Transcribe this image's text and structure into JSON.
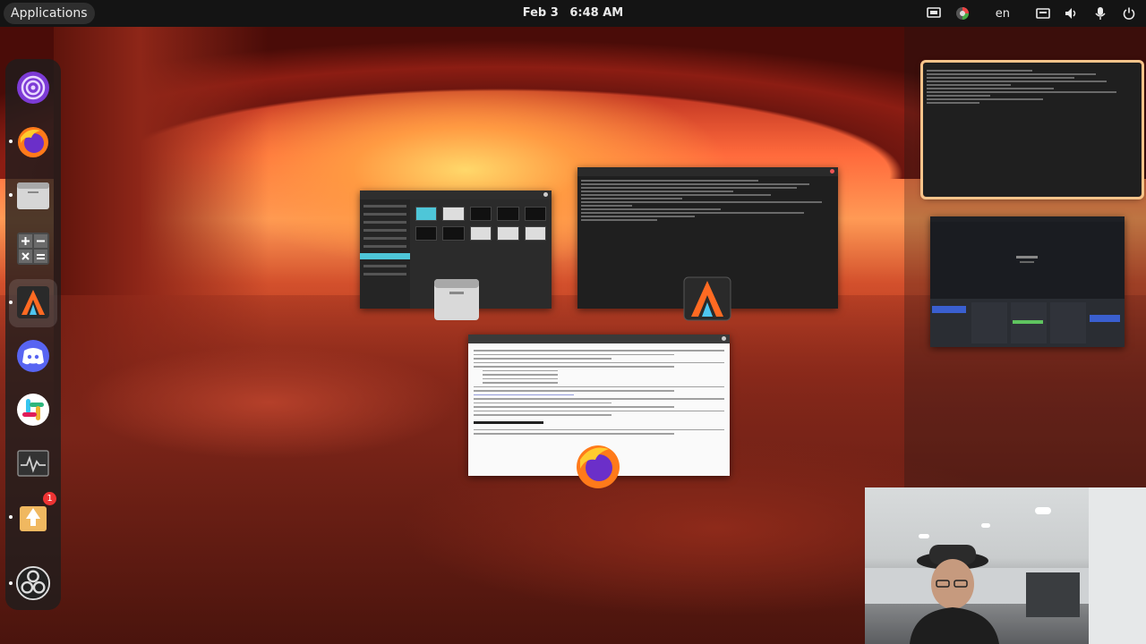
{
  "topbar": {
    "applications_label": "Applications",
    "date": "Feb 3",
    "time": "6:48 AM",
    "language": "en",
    "tray_icons": [
      "screen-share-icon",
      "color-picker-icon",
      "keyboard-icon",
      "volume-icon",
      "microphone-icon",
      "power-icon"
    ]
  },
  "dock": {
    "items": [
      {
        "name": "tor-browser",
        "icon": "tor-icon",
        "running": false
      },
      {
        "name": "firefox",
        "icon": "firefox-icon",
        "running": true
      },
      {
        "name": "files",
        "icon": "folder-icon",
        "running": true
      },
      {
        "name": "calculator",
        "icon": "calculator-icon",
        "running": false
      },
      {
        "name": "alacritty",
        "icon": "alacritty-icon",
        "running": true
      },
      {
        "name": "discord",
        "icon": "discord-icon",
        "running": false
      },
      {
        "name": "slack",
        "icon": "slack-icon",
        "running": false
      },
      {
        "name": "system-monitor",
        "icon": "system-monitor-icon",
        "running": false
      },
      {
        "name": "software-updater",
        "icon": "updater-icon",
        "running": true,
        "badge": "1"
      },
      {
        "name": "obs-studio",
        "icon": "obs-icon",
        "running": true
      }
    ]
  },
  "overview": {
    "windows": [
      {
        "name": "file-manager-window",
        "app": "Files"
      },
      {
        "name": "terminal-window",
        "app": "Alacritty"
      },
      {
        "name": "browser-window",
        "app": "Firefox"
      }
    ],
    "workspace_thumbnails": [
      {
        "name": "workspace-terminal",
        "active": true
      },
      {
        "name": "workspace-obs",
        "active": false
      }
    ]
  },
  "colors": {
    "topbar_bg": "#141414",
    "dock_bg": "#1e1e1e",
    "active_workspace_border": "#f7c48a",
    "files_accent": "#4ec6d8"
  }
}
